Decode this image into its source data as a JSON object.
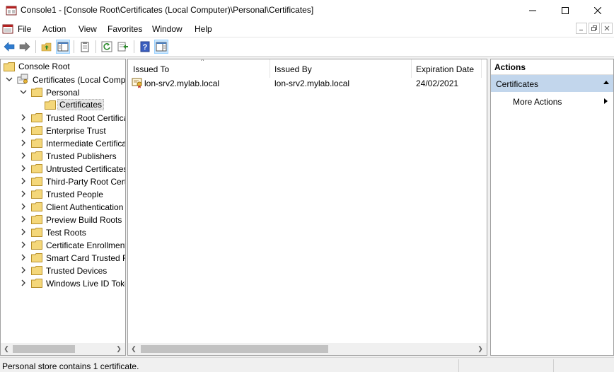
{
  "window": {
    "title": "Console1 - [Console Root\\Certificates (Local Computer)\\Personal\\Certificates]"
  },
  "menu": {
    "items": [
      "File",
      "Action",
      "View",
      "Favorites",
      "Window",
      "Help"
    ]
  },
  "toolbar": {
    "buttons": [
      "back-arrow-icon",
      "forward-arrow-icon",
      "up-folder-icon",
      "show-hide-tree-icon",
      "properties-icon",
      "refresh-icon",
      "export-list-icon",
      "help-icon",
      "show-hide-action-pane-icon"
    ]
  },
  "tree": {
    "root": "Console Root",
    "certs": "Certificates (Local Comp",
    "personal": "Personal",
    "selected": "Certificates",
    "stores": [
      "Trusted Root Certifica",
      "Enterprise Trust",
      "Intermediate Certificat",
      "Trusted Publishers",
      "Untrusted Certificates",
      "Third-Party Root Cert",
      "Trusted People",
      "Client Authentication",
      "Preview Build Roots",
      "Test Roots",
      "Certificate Enrollment",
      "Smart Card Trusted R",
      "Trusted Devices",
      "Windows Live ID Toke"
    ]
  },
  "list": {
    "columns": [
      "Issued To",
      "Issued By",
      "Expiration Date"
    ],
    "rows": [
      {
        "issued_to": "lon-srv2.mylab.local",
        "issued_by": "lon-srv2.mylab.local",
        "expiration": "24/02/2021"
      }
    ]
  },
  "actions": {
    "header": "Actions",
    "section": "Certificates",
    "items": [
      "More Actions"
    ]
  },
  "status": {
    "text": "Personal store contains 1 certificate."
  },
  "colors": {
    "selection": "#c2d6ec",
    "folder": "#e8c25a",
    "toolbar_pressed": "#cde8ff"
  }
}
